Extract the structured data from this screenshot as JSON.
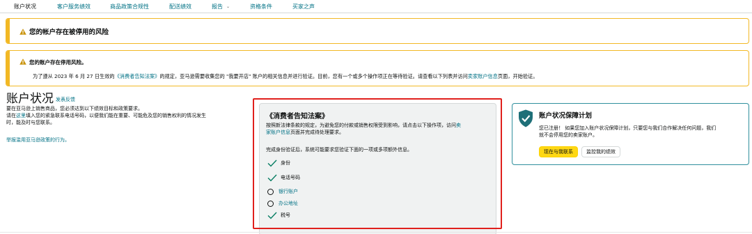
{
  "tabs": {
    "account_health": "账户状况",
    "customer_service": "客户服务绩效",
    "policy_compliance": "商品政策合规性",
    "shipping": "配送绩效",
    "reports": "报告",
    "eligibility": "资格条件",
    "buyer_voice": "买家之声"
  },
  "alert_deactivation": {
    "title": "您的帐户存在被停用的风险"
  },
  "alert_verification": {
    "title": "您的账户存在停用风险。",
    "body_prefix": "为了遵从 2023 年 6 月 27 日生效的",
    "body_link1": "《消费者告知法案》",
    "body_middle": "的规定，亚马逊需要收集您的 \"我要开店\" 账户的相关信息并进行验证。目前，您有一个或多个操作项正在等待验证。请查看以下列表并访问",
    "body_link2": "卖家账户信息",
    "body_suffix": "页面，开始验证。"
  },
  "account_health": {
    "title": "账户状况",
    "feedback_link": "发表反馈",
    "line1": "要在亚马逊上销售商品，您必须达到以下绩效目标和政策要求。",
    "line2_prefix": "请在",
    "line2_link": "这里",
    "line2_suffix": "填入您的紧急联系电话号码，以便我们能在重要、可能危及您的销售权利的情况发生",
    "line3": "时，能及时与您联系。",
    "report_link": "举报滥用亚马逊政策的行为。"
  },
  "consumer_act": {
    "title": "《消费者告知法案》",
    "desc_line1_prefix": "按照新法律条款的规定，为避免您的付款或销售权限受到影响，请点击以下操作项，访问",
    "desc_line1_link": "卖",
    "desc_line2_link": "家账户信息",
    "desc_line2_suffix": "页面并完成待处理要求。",
    "note": "完成身份验证后，系统可能要求您验证下面的一项或多项额外信息。",
    "items": [
      {
        "label": "身份",
        "status": "done"
      },
      {
        "label": "电话号码",
        "status": "done"
      },
      {
        "label": "银行账户",
        "status": "pending"
      },
      {
        "label": "办公地址",
        "status": "pending"
      },
      {
        "label": "税号",
        "status": "done"
      }
    ]
  },
  "protection_plan": {
    "title": "账户状况保障计划",
    "desc_line1": "您已注册！ 如果您加入账户状况保障计划，只要您与我们合作解决任何问题，我们",
    "desc_line2": "就不会停用您的卖家账户。",
    "contact_button": "现在与我联系",
    "monitor_button": "监控我的绩效"
  },
  "colors": {
    "link": "#007185",
    "warning": "#f2b824",
    "highlight_frame": "#e0201c",
    "check": "#067d62",
    "primary_button": "#ffd814",
    "teal_border": "#2f8f9d"
  }
}
